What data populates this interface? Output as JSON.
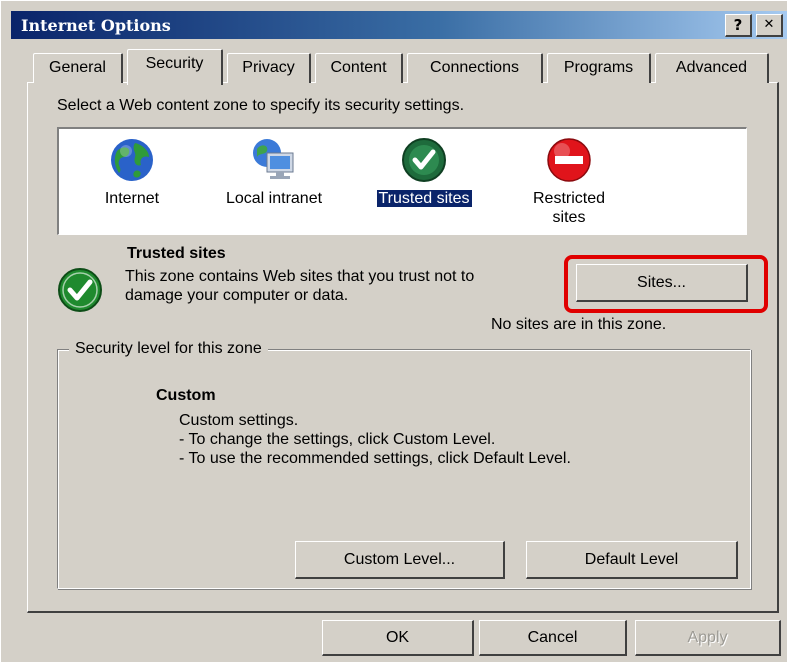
{
  "window": {
    "title": "Internet Options",
    "help_btn": "?",
    "close_btn": "✕"
  },
  "tabs": [
    {
      "label": "General"
    },
    {
      "label": "Security",
      "active": true
    },
    {
      "label": "Privacy"
    },
    {
      "label": "Content"
    },
    {
      "label": "Connections"
    },
    {
      "label": "Programs"
    },
    {
      "label": "Advanced"
    }
  ],
  "security": {
    "instruction": "Select a Web content zone to specify its security settings.",
    "zones": [
      {
        "label": "Internet",
        "icon": "globe-icon"
      },
      {
        "label": "Local intranet",
        "icon": "intranet-monitor-icon"
      },
      {
        "label": "Trusted sites",
        "icon": "trusted-check-icon",
        "selected": true
      },
      {
        "label_line1": "Restricted",
        "label_line2": "sites",
        "icon": "restricted-no-entry-icon"
      }
    ],
    "selected_zone": {
      "title": "Trusted sites",
      "description": "This zone contains Web sites that you trust not to damage your computer or data.",
      "sites_button": "Sites...",
      "sites_status": "No sites are in this zone."
    },
    "level_group": {
      "legend": "Security level for this zone",
      "level_name": "Custom",
      "line1": "Custom settings.",
      "line2": "- To change the settings, click Custom Level.",
      "line3": "- To use the recommended settings, click Default Level.",
      "custom_button": "Custom Level...",
      "default_button": "Default Level"
    }
  },
  "footer": {
    "ok": "OK",
    "cancel": "Cancel",
    "apply": "Apply"
  },
  "colors": {
    "titlebar": "#0a246a",
    "selection": "#0a246a",
    "highlight_box": "#e00000",
    "dialog_bg": "#d4d0c8"
  }
}
